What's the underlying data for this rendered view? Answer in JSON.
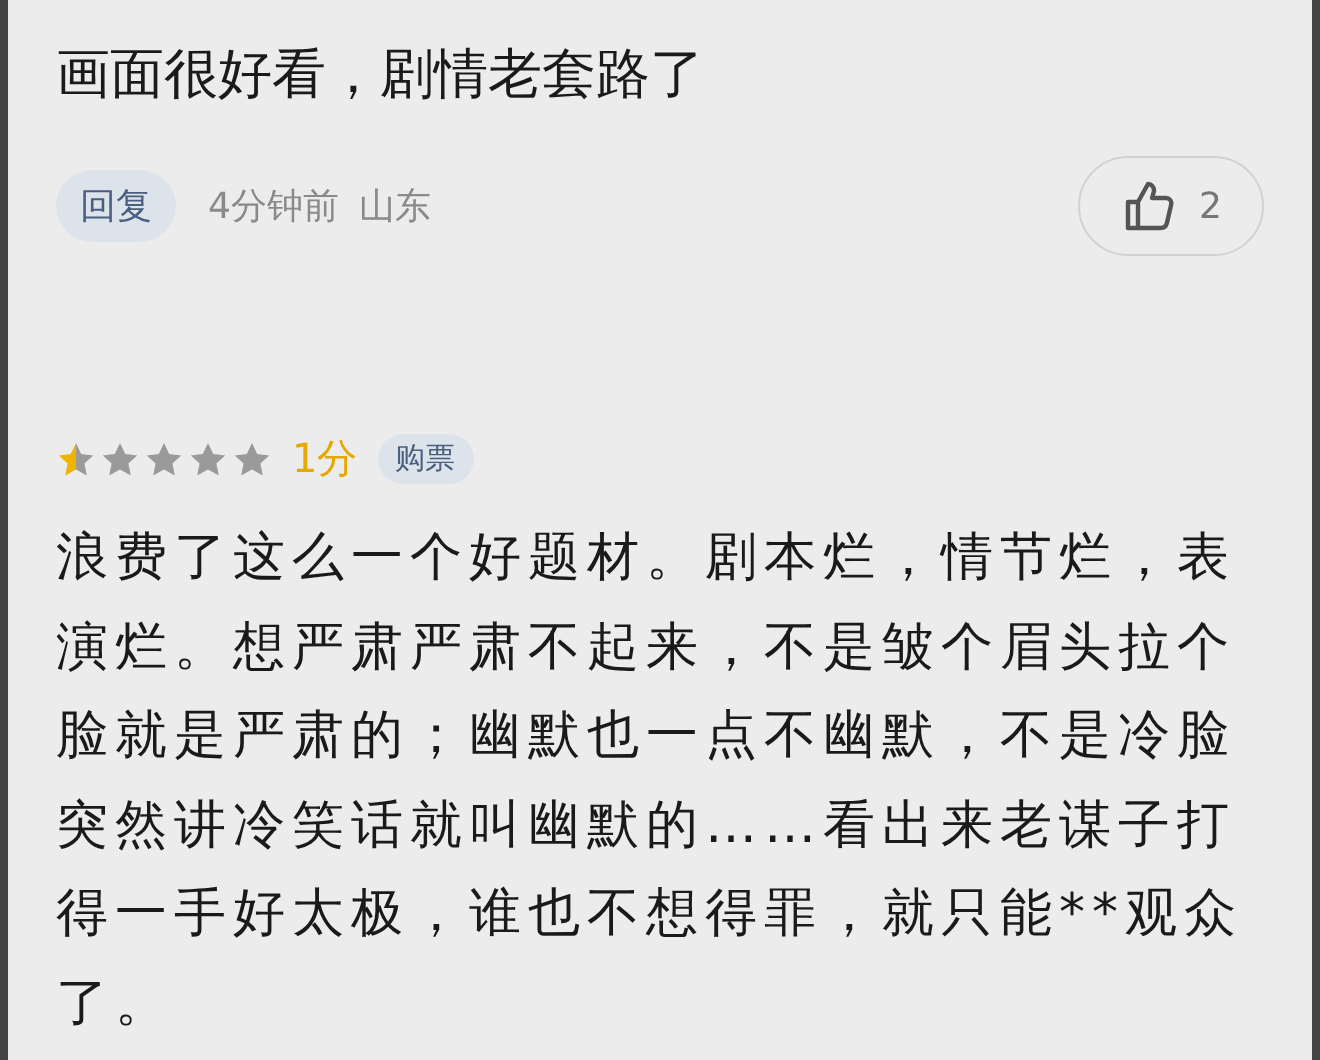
{
  "comments": [
    {
      "kind": "reply",
      "text": "画面很好看，剧情老套路了",
      "reply_button": "回复",
      "time": "4分钟前",
      "location": "山东",
      "likes": "2"
    },
    {
      "kind": "review",
      "stars": 0.5,
      "score": "1分",
      "tag": "购票",
      "text": "浪费了这么一个好题材。剧本烂，情节烂，表演烂。想严肃严肃不起来，不是皱个眉头拉个脸就是严肃的；幽默也一点不幽默，不是冷脸突然讲冷笑话就叫幽默的……看出来老谋子打得一手好太极，谁也不想得罪，就只能**观众了。"
    }
  ]
}
